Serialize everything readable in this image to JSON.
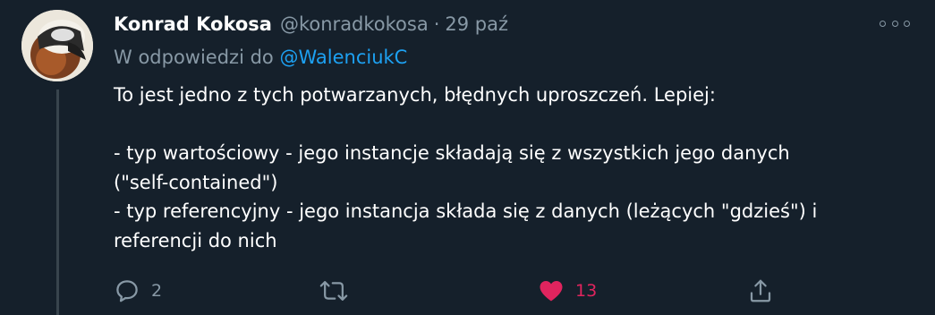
{
  "tweet": {
    "author": {
      "display_name": "Konrad Kokosa",
      "handle": "@konradkokosa",
      "separator": "·",
      "date": "29 paź"
    },
    "reply_to": {
      "prefix": "W odpowiedzi do",
      "mention": "@WalenciukC"
    },
    "text_lines": [
      "To jest jedno z tych potwarzanych, błędnych uproszczeń. Lepiej:",
      "",
      "- typ wartościowy - jego instancje składają się z wszystkich jego danych",
      "(\"self-contained\")",
      "- typ referencyjny - jego instancja składa się z danych (leżących \"gdzieś\") i",
      "referencji do nich"
    ],
    "actions": {
      "reply": {
        "icon": "reply-icon",
        "count": "2"
      },
      "retweet": {
        "icon": "retweet-icon",
        "count": ""
      },
      "like": {
        "icon": "heart-icon",
        "count": "13",
        "liked": true,
        "color": "#e0245e"
      },
      "share": {
        "icon": "share-icon"
      }
    },
    "more_icon": "more-options-icon"
  },
  "theme": {
    "background": "#15202b",
    "text": "#ffffff",
    "secondary": "#8899a6",
    "link": "#1da1f2",
    "like": "#e0245e"
  }
}
